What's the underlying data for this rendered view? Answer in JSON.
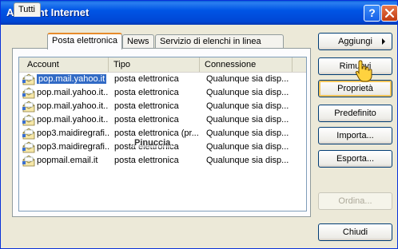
{
  "window": {
    "title": "Account Internet"
  },
  "titlebar": {
    "help_glyph": "?"
  },
  "tabs": [
    {
      "label": "Tutti"
    },
    {
      "label": "Posta elettronica"
    },
    {
      "label": "News"
    },
    {
      "label": "Servizio di elenchi in linea"
    }
  ],
  "list": {
    "columns": [
      "Account",
      "Tipo",
      "Connessione"
    ],
    "rows": [
      {
        "account": "pop.mail.yahoo.it",
        "tipo": "posta elettronica",
        "conn": "Qualunque sia disp..."
      },
      {
        "account": "pop.mail.yahoo.it...",
        "tipo": "posta elettronica",
        "conn": "Qualunque sia disp..."
      },
      {
        "account": "pop.mail.yahoo.it...",
        "tipo": "posta elettronica",
        "conn": "Qualunque sia disp..."
      },
      {
        "account": "pop.mail.yahoo.it...",
        "tipo": "posta elettronica",
        "conn": "Qualunque sia disp..."
      },
      {
        "account": "pop3.maidiregrafi...",
        "tipo": "posta elettronica (pr...",
        "conn": "Qualunque sia disp..."
      },
      {
        "account": "pop3.maidiregrafi...",
        "tipo": "posta elettronica",
        "conn": "Qualunque sia disp..."
      },
      {
        "account": "popmail.email.it",
        "tipo": "posta elettronica",
        "conn": "Qualunque sia disp..."
      }
    ]
  },
  "buttons": {
    "aggiungi": "Aggiungi",
    "rimuovi": "Rimuovi",
    "proprieta": "Proprietà",
    "predefinito": "Predefinito",
    "importa": "Importa...",
    "esporta": "Esporta...",
    "ordina": "Ordina...",
    "chiudi": "Chiudi"
  },
  "watermark": "Pinuccia",
  "colors": {
    "title_bar": "#0055e5",
    "selection": "#316ac5",
    "window_bg": "#ece9d8",
    "close_button": "#c03a10"
  },
  "icons": [
    "help-icon",
    "close-icon",
    "mail-account-icon",
    "chevron-right-icon",
    "hand-cursor-icon"
  ]
}
